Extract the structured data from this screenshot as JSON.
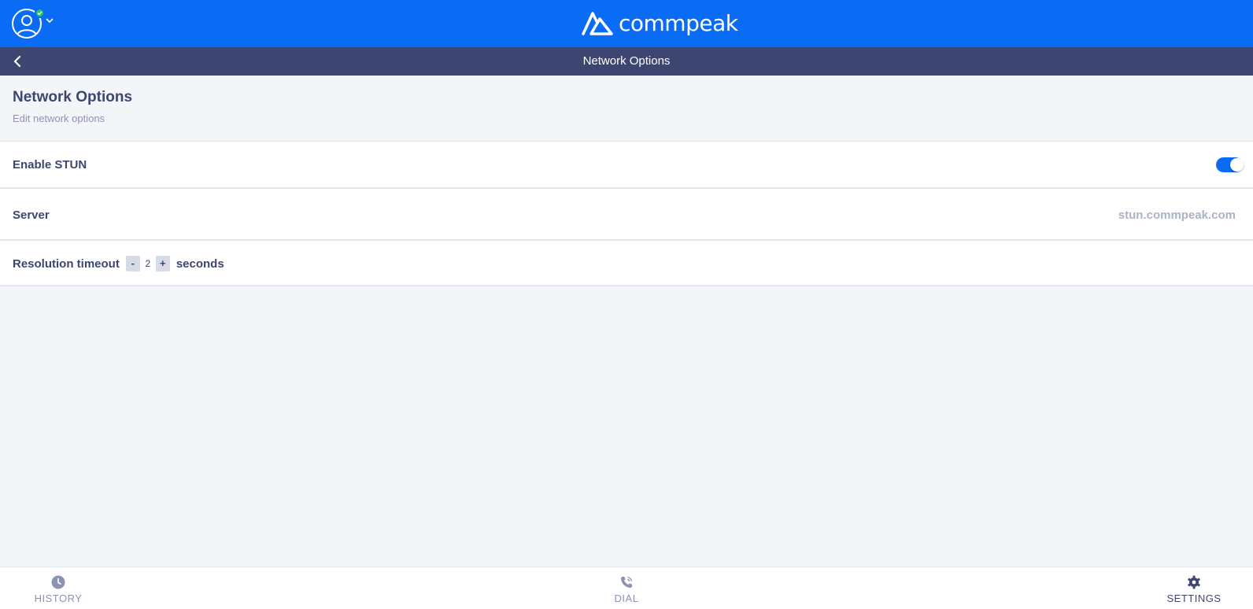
{
  "app": {
    "brand": "commpeak",
    "accent_color": "#0a6cf5",
    "header_color": "#3c4670",
    "status_color": "#22c55e"
  },
  "topbar": {
    "avatar_icon": "user-avatar-icon",
    "status_icon": "check-icon",
    "menu_icon": "chevron-down-icon"
  },
  "subbar": {
    "title": "Network Options",
    "back_icon": "chevron-left-icon"
  },
  "page": {
    "title": "Network Options",
    "subtitle": "Edit network options"
  },
  "settings": {
    "stun": {
      "label": "Enable STUN",
      "enabled": true
    },
    "server": {
      "label": "Server",
      "value": "stun.commpeak.com"
    },
    "timeout": {
      "label": "Resolution timeout",
      "decrement": "-",
      "value": "2",
      "increment": "+",
      "unit": "seconds"
    }
  },
  "bottom_nav": {
    "history": {
      "label": "HISTORY",
      "icon": "clock-icon"
    },
    "dial": {
      "label": "DIAL",
      "icon": "phone-icon"
    },
    "settings": {
      "label": "SETTINGS",
      "icon": "gear-icon",
      "active": true
    }
  }
}
